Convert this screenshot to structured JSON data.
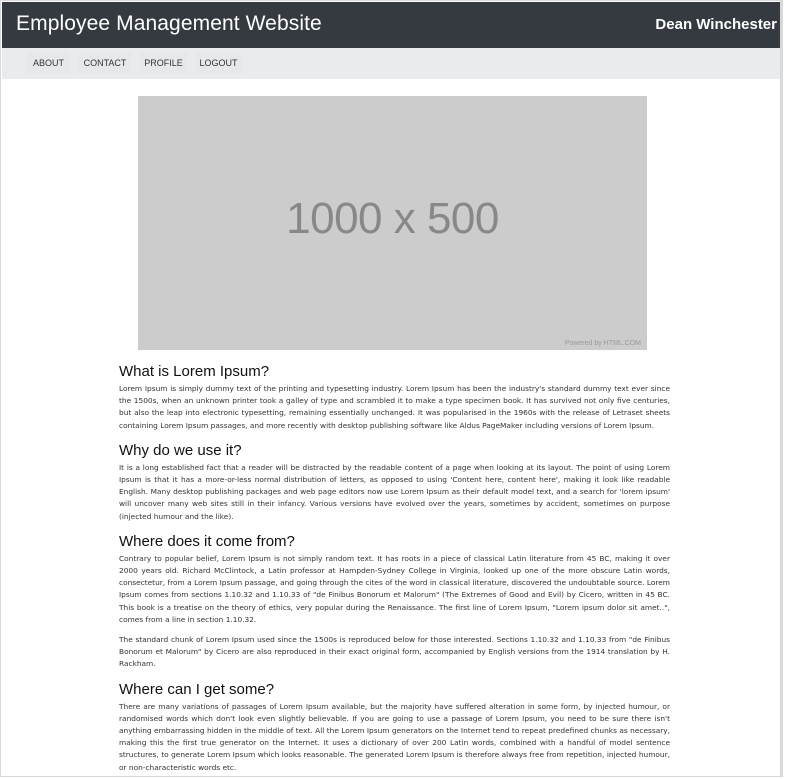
{
  "header": {
    "title": "Employee Management Website",
    "user_name": "Dean Winchester"
  },
  "nav": {
    "items": [
      {
        "label": "ABOUT"
      },
      {
        "label": "CONTACT"
      },
      {
        "label": "PROFILE"
      },
      {
        "label": "LOGOUT"
      }
    ]
  },
  "hero": {
    "label": "1000 x 500",
    "credit": "Powered by HTML.COM"
  },
  "sections": [
    {
      "heading": "What is Lorem Ipsum?",
      "paragraphs": [
        "Lorem Ipsum is simply dummy text of the printing and typesetting industry. Lorem Ipsum has been the industry's standard dummy text ever since the 1500s, when an unknown printer took a galley of type and scrambled it to make a type specimen book. It has survived not only five centuries, but also the leap into electronic typesetting, remaining essentially unchanged. It was popularised in the 1960s with the release of Letraset sheets containing Lorem Ipsum passages, and more recently with desktop publishing software like Aldus PageMaker including versions of Lorem Ipsum."
      ]
    },
    {
      "heading": "Why do we use it?",
      "paragraphs": [
        "It is a long established fact that a reader will be distracted by the readable content of a page when looking at its layout. The point of using Lorem Ipsum is that it has a more-or-less normal distribution of letters, as opposed to using 'Content here, content here', making it look like readable English. Many desktop publishing packages and web page editors now use Lorem Ipsum as their default model text, and a search for 'lorem ipsum' will uncover many web sites still in their infancy. Various versions have evolved over the years, sometimes by accident, sometimes on purpose (injected humour and the like)."
      ]
    },
    {
      "heading": "Where does it come from?",
      "paragraphs": [
        "Contrary to popular belief, Lorem Ipsum is not simply random text. It has roots in a piece of classical Latin literature from 45 BC, making it over 2000 years old. Richard McClintock, a Latin professor at Hampden-Sydney College in Virginia, looked up one of the more obscure Latin words, consectetur, from a Lorem Ipsum passage, and going through the cites of the word in classical literature, discovered the undoubtable source. Lorem Ipsum comes from sections 1.10.32 and 1.10.33 of \"de Finibus Bonorum et Malorum\" (The Extremes of Good and Evil) by Cicero, written in 45 BC. This book is a treatise on the theory of ethics, very popular during the Renaissance. The first line of Lorem Ipsum, \"Lorem ipsum dolor sit amet..\", comes from a line in section 1.10.32.",
        "The standard chunk of Lorem Ipsum used since the 1500s is reproduced below for those interested. Sections 1.10.32 and 1.10.33 from \"de Finibus Bonorum et Malorum\" by Cicero are also reproduced in their exact original form, accompanied by English versions from the 1914 translation by H. Rackham."
      ]
    },
    {
      "heading": "Where can I get some?",
      "paragraphs": [
        "There are many variations of passages of Lorem Ipsum available, but the majority have suffered alteration in some form, by injected humour, or randomised words which don't look even slightly believable. If you are going to use a passage of Lorem Ipsum, you need to be sure there isn't anything embarrassing hidden in the middle of text. All the Lorem Ipsum generators on the Internet tend to repeat predefined chunks as necessary, making this the first true generator on the Internet. It uses a dictionary of over 200 Latin words, combined with a handful of model sentence structures, to generate Lorem Ipsum which looks reasonable. The generated Lorem Ipsum is therefore always free from repetition, injected humour, or non-characteristic words etc."
      ]
    }
  ]
}
